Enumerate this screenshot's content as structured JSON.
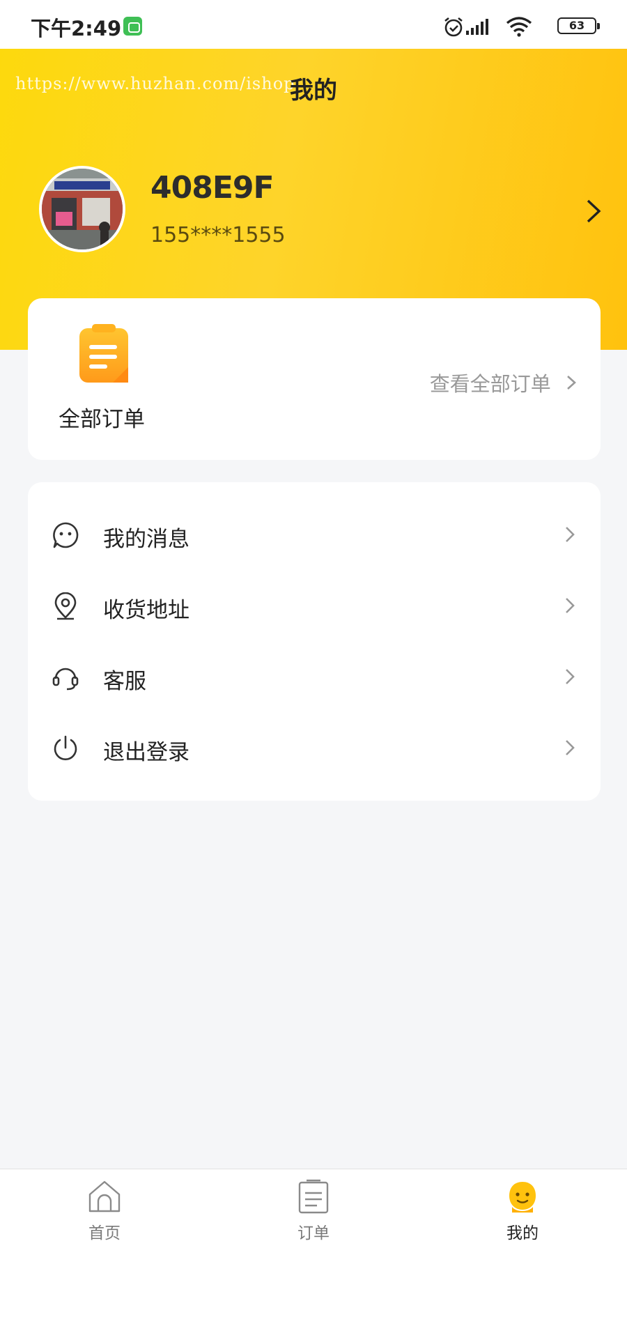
{
  "status_bar": {
    "time": "下午2:49",
    "battery": "63"
  },
  "header": {
    "watermark": "https://www.huzhan.com/ishop",
    "title": "我的"
  },
  "profile": {
    "name": "408E9F",
    "phone": "155****1555"
  },
  "orders": {
    "label": "全部订单",
    "view_all": "查看全部订单"
  },
  "menu": [
    {
      "label": "我的消息",
      "icon": "message-icon"
    },
    {
      "label": "收货地址",
      "icon": "location-icon"
    },
    {
      "label": "客服",
      "icon": "headset-icon"
    },
    {
      "label": "退出登录",
      "icon": "power-icon"
    }
  ],
  "tabbar": [
    {
      "label": "首页",
      "icon": "home-icon"
    },
    {
      "label": "订单",
      "icon": "order-list-icon"
    },
    {
      "label": "我的",
      "icon": "profile-face-icon"
    }
  ],
  "colors": {
    "accent": "#FFC20E",
    "header_gradient_start": "#FDD90D",
    "background": "#F5F6F8"
  }
}
